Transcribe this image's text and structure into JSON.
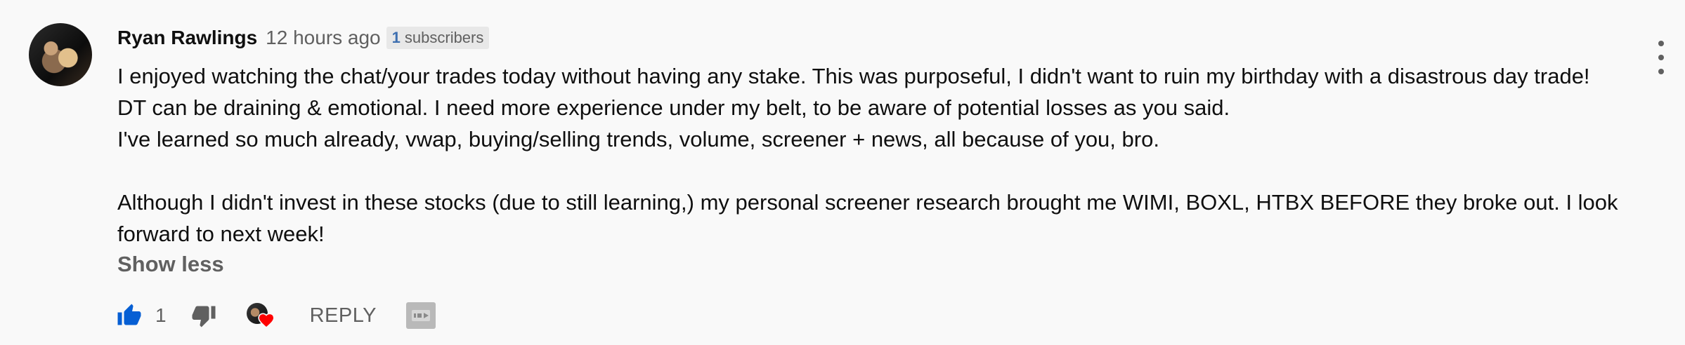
{
  "comment": {
    "author": "Ryan Rawlings",
    "timestamp": "12 hours ago",
    "subscriber_count": "1",
    "subscriber_label": "subscribers",
    "lines": [
      "I enjoyed watching the chat/your trades today without having any stake. This was purposeful, I didn't want to ruin my birthday with a disastrous day trade!",
      "DT can be draining & emotional. I need more experience under my belt, to be aware of potential losses as you said.",
      "I've learned so much already, vwap, buying/selling trends, volume, screener + news, all because of you, bro.",
      "Although I didn't invest in these stocks (due to still learning,) my personal screener research brought me WIMI, BOXL, HTBX BEFORE they broke out. I look",
      "forward to next week!"
    ],
    "show_less_label": "Show less",
    "like_count": "1",
    "reply_label": "REPLY",
    "icons": {
      "like": "thumbs-up-icon",
      "dislike": "thumbs-down-icon",
      "hearted": "heart-icon",
      "menu": "more-vert-icon",
      "extension": "extension-icon"
    },
    "colors": {
      "like_active": "#065fd4",
      "heart": "#ff0000",
      "subscriber_count": "#3e6fb0"
    }
  }
}
